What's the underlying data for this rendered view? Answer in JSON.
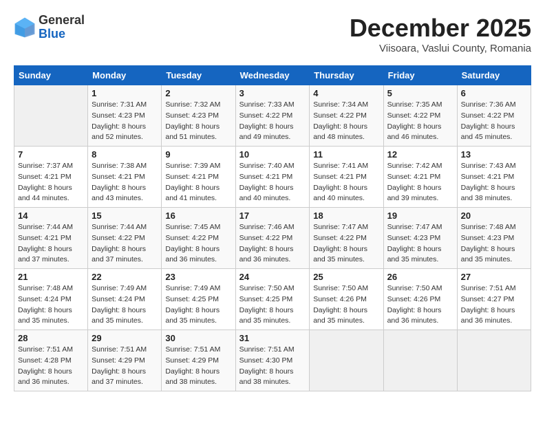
{
  "header": {
    "logo_line1": "General",
    "logo_line2": "Blue",
    "month": "December 2025",
    "location": "Viisoara, Vaslui County, Romania"
  },
  "weekdays": [
    "Sunday",
    "Monday",
    "Tuesday",
    "Wednesday",
    "Thursday",
    "Friday",
    "Saturday"
  ],
  "weeks": [
    [
      {
        "day": "",
        "info": ""
      },
      {
        "day": "1",
        "info": "Sunrise: 7:31 AM\nSunset: 4:23 PM\nDaylight: 8 hours\nand 52 minutes."
      },
      {
        "day": "2",
        "info": "Sunrise: 7:32 AM\nSunset: 4:23 PM\nDaylight: 8 hours\nand 51 minutes."
      },
      {
        "day": "3",
        "info": "Sunrise: 7:33 AM\nSunset: 4:22 PM\nDaylight: 8 hours\nand 49 minutes."
      },
      {
        "day": "4",
        "info": "Sunrise: 7:34 AM\nSunset: 4:22 PM\nDaylight: 8 hours\nand 48 minutes."
      },
      {
        "day": "5",
        "info": "Sunrise: 7:35 AM\nSunset: 4:22 PM\nDaylight: 8 hours\nand 46 minutes."
      },
      {
        "day": "6",
        "info": "Sunrise: 7:36 AM\nSunset: 4:22 PM\nDaylight: 8 hours\nand 45 minutes."
      }
    ],
    [
      {
        "day": "7",
        "info": "Sunrise: 7:37 AM\nSunset: 4:21 PM\nDaylight: 8 hours\nand 44 minutes."
      },
      {
        "day": "8",
        "info": "Sunrise: 7:38 AM\nSunset: 4:21 PM\nDaylight: 8 hours\nand 43 minutes."
      },
      {
        "day": "9",
        "info": "Sunrise: 7:39 AM\nSunset: 4:21 PM\nDaylight: 8 hours\nand 41 minutes."
      },
      {
        "day": "10",
        "info": "Sunrise: 7:40 AM\nSunset: 4:21 PM\nDaylight: 8 hours\nand 40 minutes."
      },
      {
        "day": "11",
        "info": "Sunrise: 7:41 AM\nSunset: 4:21 PM\nDaylight: 8 hours\nand 40 minutes."
      },
      {
        "day": "12",
        "info": "Sunrise: 7:42 AM\nSunset: 4:21 PM\nDaylight: 8 hours\nand 39 minutes."
      },
      {
        "day": "13",
        "info": "Sunrise: 7:43 AM\nSunset: 4:21 PM\nDaylight: 8 hours\nand 38 minutes."
      }
    ],
    [
      {
        "day": "14",
        "info": "Sunrise: 7:44 AM\nSunset: 4:21 PM\nDaylight: 8 hours\nand 37 minutes."
      },
      {
        "day": "15",
        "info": "Sunrise: 7:44 AM\nSunset: 4:22 PM\nDaylight: 8 hours\nand 37 minutes."
      },
      {
        "day": "16",
        "info": "Sunrise: 7:45 AM\nSunset: 4:22 PM\nDaylight: 8 hours\nand 36 minutes."
      },
      {
        "day": "17",
        "info": "Sunrise: 7:46 AM\nSunset: 4:22 PM\nDaylight: 8 hours\nand 36 minutes."
      },
      {
        "day": "18",
        "info": "Sunrise: 7:47 AM\nSunset: 4:22 PM\nDaylight: 8 hours\nand 35 minutes."
      },
      {
        "day": "19",
        "info": "Sunrise: 7:47 AM\nSunset: 4:23 PM\nDaylight: 8 hours\nand 35 minutes."
      },
      {
        "day": "20",
        "info": "Sunrise: 7:48 AM\nSunset: 4:23 PM\nDaylight: 8 hours\nand 35 minutes."
      }
    ],
    [
      {
        "day": "21",
        "info": "Sunrise: 7:48 AM\nSunset: 4:24 PM\nDaylight: 8 hours\nand 35 minutes."
      },
      {
        "day": "22",
        "info": "Sunrise: 7:49 AM\nSunset: 4:24 PM\nDaylight: 8 hours\nand 35 minutes."
      },
      {
        "day": "23",
        "info": "Sunrise: 7:49 AM\nSunset: 4:25 PM\nDaylight: 8 hours\nand 35 minutes."
      },
      {
        "day": "24",
        "info": "Sunrise: 7:50 AM\nSunset: 4:25 PM\nDaylight: 8 hours\nand 35 minutes."
      },
      {
        "day": "25",
        "info": "Sunrise: 7:50 AM\nSunset: 4:26 PM\nDaylight: 8 hours\nand 35 minutes."
      },
      {
        "day": "26",
        "info": "Sunrise: 7:50 AM\nSunset: 4:26 PM\nDaylight: 8 hours\nand 36 minutes."
      },
      {
        "day": "27",
        "info": "Sunrise: 7:51 AM\nSunset: 4:27 PM\nDaylight: 8 hours\nand 36 minutes."
      }
    ],
    [
      {
        "day": "28",
        "info": "Sunrise: 7:51 AM\nSunset: 4:28 PM\nDaylight: 8 hours\nand 36 minutes."
      },
      {
        "day": "29",
        "info": "Sunrise: 7:51 AM\nSunset: 4:29 PM\nDaylight: 8 hours\nand 37 minutes."
      },
      {
        "day": "30",
        "info": "Sunrise: 7:51 AM\nSunset: 4:29 PM\nDaylight: 8 hours\nand 38 minutes."
      },
      {
        "day": "31",
        "info": "Sunrise: 7:51 AM\nSunset: 4:30 PM\nDaylight: 8 hours\nand 38 minutes."
      },
      {
        "day": "",
        "info": ""
      },
      {
        "day": "",
        "info": ""
      },
      {
        "day": "",
        "info": ""
      }
    ]
  ]
}
